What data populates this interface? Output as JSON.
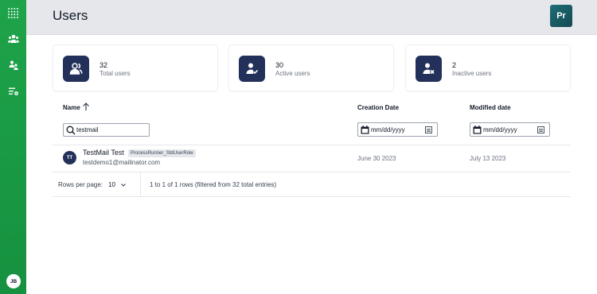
{
  "header": {
    "title": "Users",
    "app_badge": "Pr"
  },
  "sidebar": {
    "items": [
      {
        "icon": "apps-grid-icon"
      },
      {
        "icon": "users-icon"
      },
      {
        "icon": "groups-icon"
      },
      {
        "icon": "roles-settings-icon"
      }
    ],
    "user_initials": "JB"
  },
  "stats": [
    {
      "value": "32",
      "label": "Total users",
      "icon": "users-icon"
    },
    {
      "value": "30",
      "label": "Active users",
      "icon": "active-user-icon"
    },
    {
      "value": "2",
      "label": "Inactive users",
      "icon": "inactive-user-icon"
    }
  ],
  "table": {
    "columns": {
      "name": "Name",
      "creation": "Creation Date",
      "modified": "Modified date"
    },
    "sort": "ascending",
    "filters": {
      "search_value": "testmail",
      "creation_placeholder": "mm/dd/yyyy",
      "modified_placeholder": "mm/dd/yyyy"
    },
    "rows": [
      {
        "initials": "TT",
        "name": "TestMail Test",
        "role": "ProcessRunner_StdUserRole",
        "email": "testdemo1@mailinator.com",
        "created": "June 30 2023",
        "modified": "July 13 2023"
      }
    ]
  },
  "footer": {
    "rows_per_page_label": "Rows per page:",
    "rows_per_page_value": "10",
    "page_info": "1 to 1 of 1 rows (filtered from 32 total entries)"
  },
  "colors": {
    "sidebar": "#1ea34a",
    "accent_dark": "#23305a",
    "header_bg": "#e5e7eb"
  }
}
